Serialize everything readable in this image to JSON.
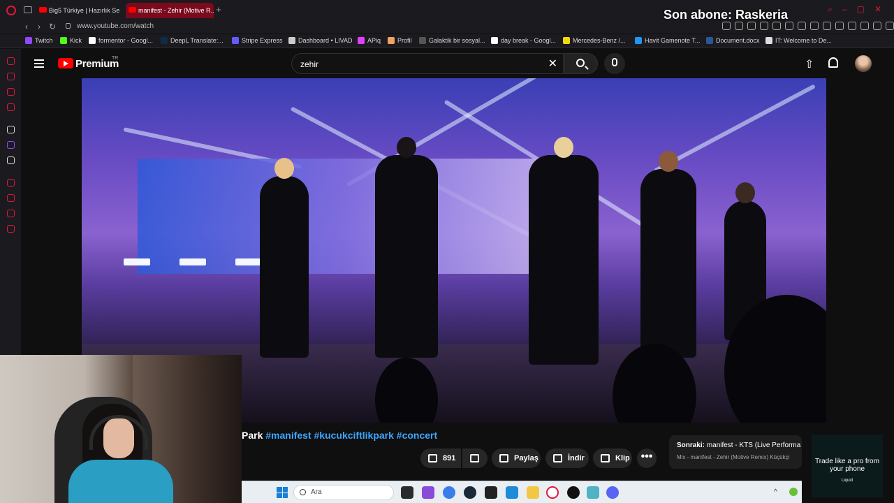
{
  "browser": {
    "tabs": [
      {
        "title": "Big5 Türkiye | Hazırlık Se..."
      },
      {
        "title": "manifest - Zehir (Motive R..."
      }
    ],
    "url": "www.youtube.com/watch",
    "bookmarks": [
      {
        "label": "Twitch",
        "color": "#9146ff"
      },
      {
        "label": "Kick",
        "color": "#53fc18"
      },
      {
        "label": "formentor - Googl...",
        "color": "#ffffff"
      },
      {
        "label": "DeepL Translate:...",
        "color": "#0f2b46"
      },
      {
        "label": "Stripe Express",
        "color": "#635bff"
      },
      {
        "label": "Dashboard • LIVAD",
        "color": "#cccccc"
      },
      {
        "label": "APiq",
        "color": "#e040fb"
      },
      {
        "label": "Profil",
        "color": "#f4a261"
      },
      {
        "label": "Galaktik bir sosyal...",
        "color": "#555555"
      },
      {
        "label": "day break - Googl...",
        "color": "#ffffff"
      },
      {
        "label": "Mercedes-Benz /...",
        "color": "#f5d90a"
      },
      {
        "label": "Havit Gamenote T...",
        "color": "#2196f3"
      },
      {
        "label": "Document.docx",
        "color": "#2b579a"
      },
      {
        "label": "IT: Welcome to De...",
        "color": "#dddddd"
      }
    ]
  },
  "overlay": {
    "last_subscriber": "Son abone: Raskeria"
  },
  "youtube": {
    "brand": "Premium",
    "region": "TR",
    "search_query": "zehir",
    "video": {
      "title_prefix": "Park",
      "hashtags": [
        "#manifest",
        "#kucukciftlikpark",
        "#concert"
      ]
    },
    "actions": {
      "likes": "891",
      "share": "Paylaş",
      "download": "İndir",
      "clip": "Klip",
      "more": "•••"
    },
    "next_up": {
      "label": "Sonraki:",
      "title": "manifest - KTS (Live Performa",
      "subtitle": "Mix - manifest - Zehir (Motive Remix) Küçükçi"
    }
  },
  "ad": {
    "text": "Trade like a pro from your phone",
    "brand": "Liquid"
  },
  "taskbar": {
    "search_placeholder": "Ara"
  }
}
